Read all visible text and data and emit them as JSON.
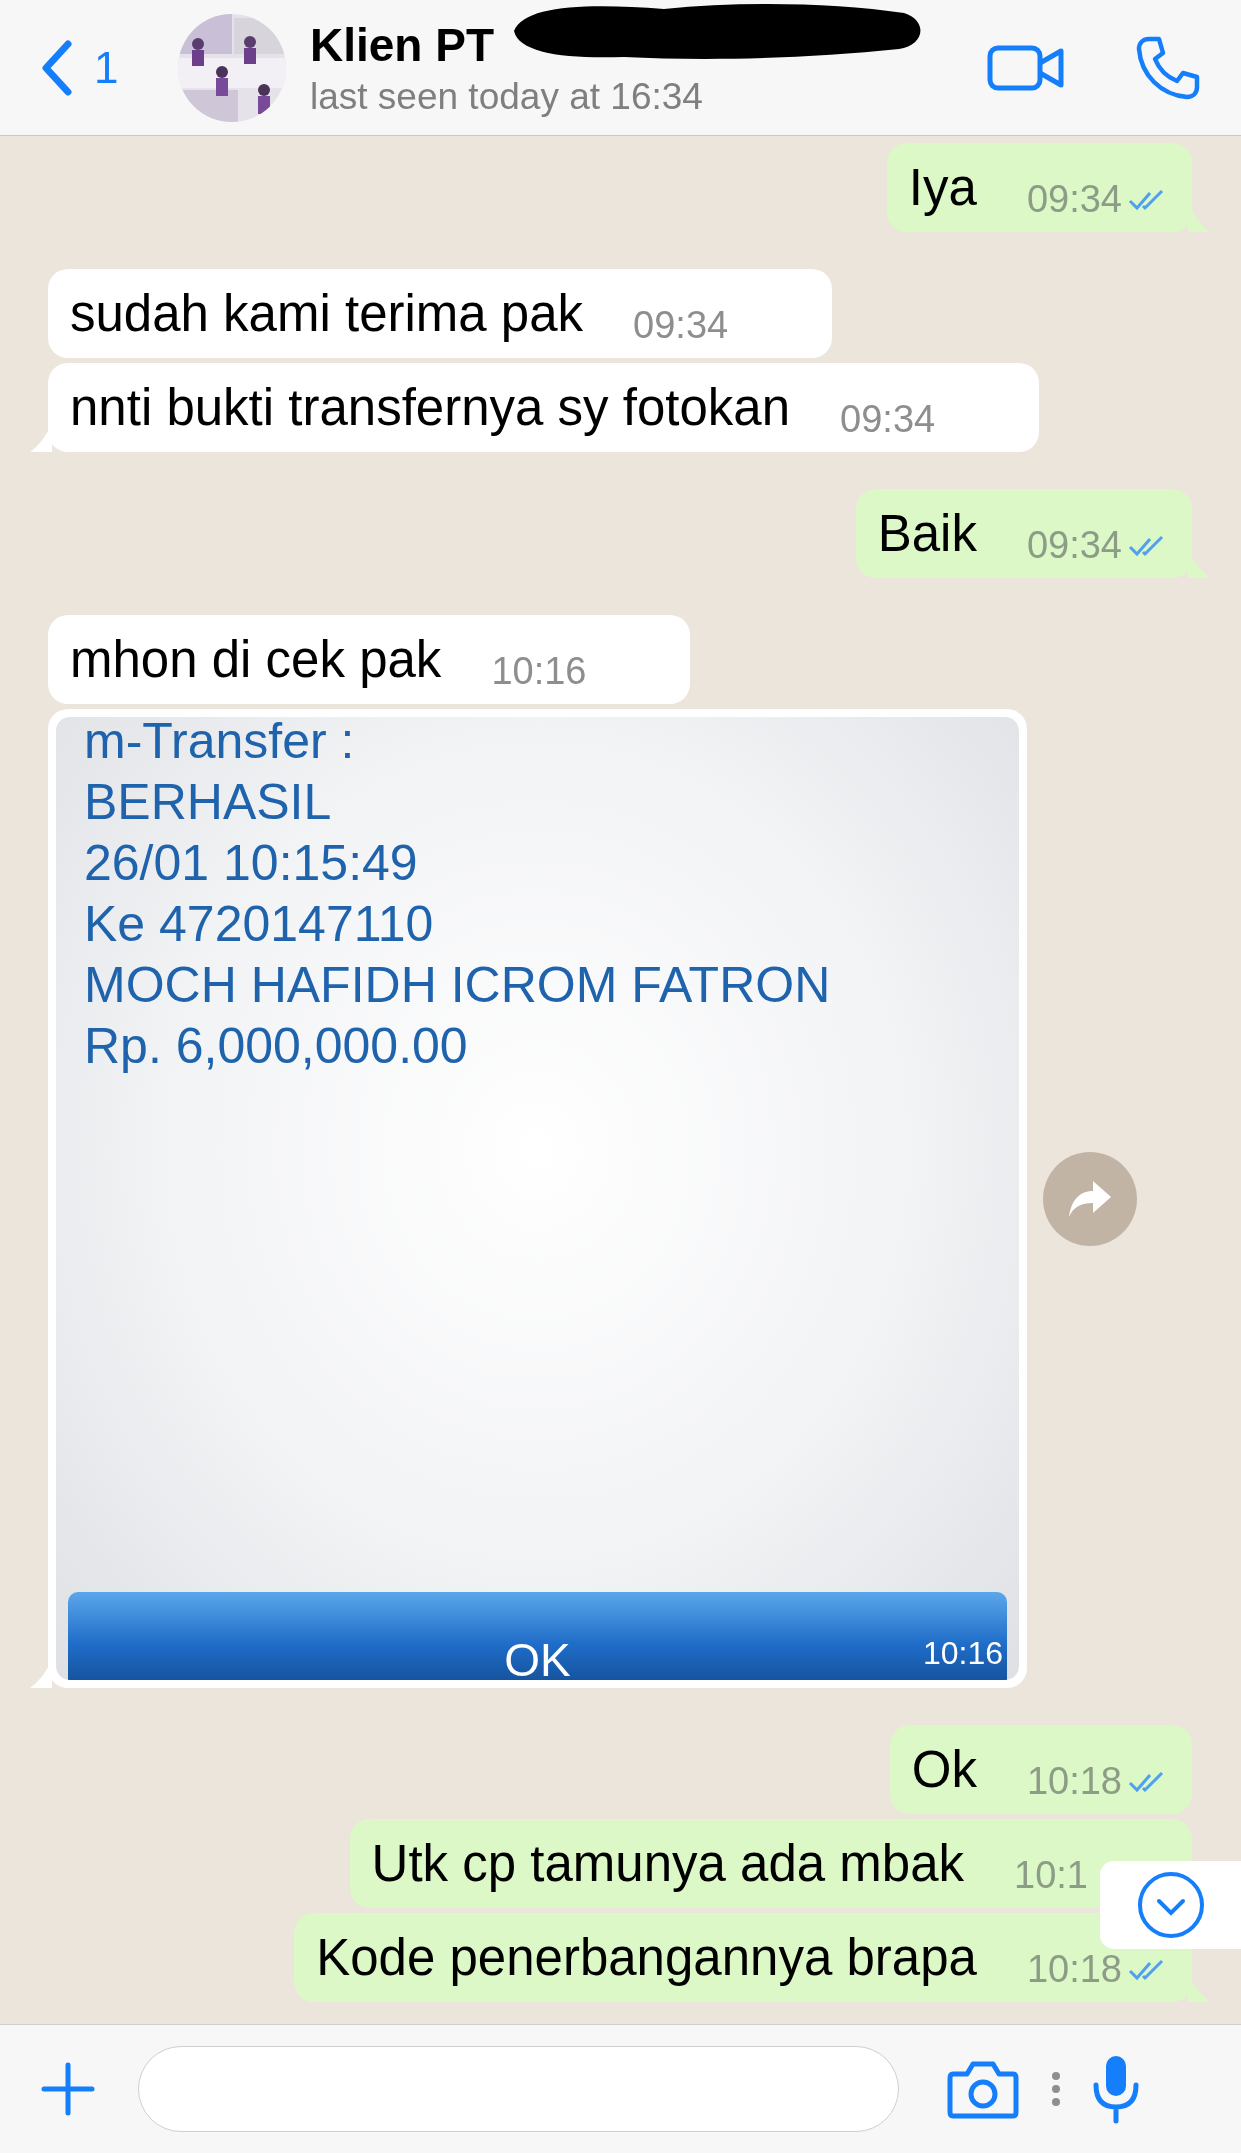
{
  "header": {
    "back_count": "1",
    "title": "Klien PT",
    "redacted": true,
    "status": "last seen today at 16:34"
  },
  "messages": [
    {
      "kind": "text",
      "outgoing": true,
      "text": "Iya",
      "time": "09:34",
      "read": true
    },
    {
      "kind": "text",
      "outgoing": false,
      "text": "sudah kami terima pak",
      "time": "09:34"
    },
    {
      "kind": "text",
      "outgoing": false,
      "text": "nnti bukti transfernya sy fotokan",
      "time": "09:34"
    },
    {
      "kind": "text",
      "outgoing": true,
      "text": "Baik",
      "time": "09:34",
      "read": true
    },
    {
      "kind": "text",
      "outgoing": false,
      "text": "mhon di cek pak",
      "time": "10:16"
    },
    {
      "outgoing": false,
      "lines": [
        "m-Transfer :",
        "BERHASIL",
        "26/01 10:15:49",
        "Ke 4720147110",
        "MOCH HAFIDH ICROM FATRON",
        "Rp. 6,000,000.00"
      ],
      "button": "OK",
      "time": "10:16"
    },
    {
      "kind": "text",
      "outgoing": true,
      "text": "Ok",
      "time": "10:18",
      "read": true
    },
    {
      "kind": "text",
      "outgoing": true,
      "text": "Utk cp tamunya ada mbak",
      "time": "10:1"
    },
    {
      "kind": "text",
      "outgoing": true,
      "text": "Kode penerbangannya brapa",
      "time": "10:18",
      "read": true
    }
  ]
}
